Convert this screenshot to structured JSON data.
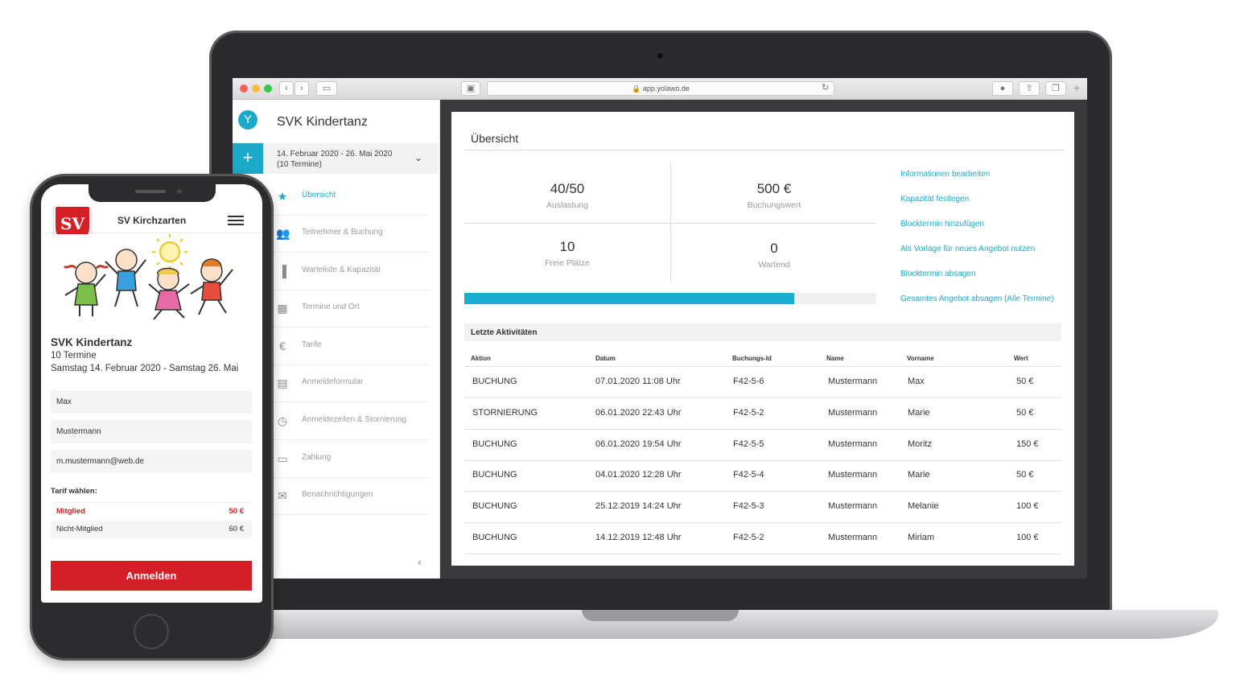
{
  "browser": {
    "url": "app.yolawo.de"
  },
  "sidebar": {
    "title": "SVK Kindertanz",
    "date_range": "14. Februar 2020 - 26. Mai 2020\n(10 Termine)",
    "items": [
      {
        "label": "Übersicht",
        "icon": "star-icon",
        "active": true
      },
      {
        "label": "Teilnehmer & Buchung",
        "icon": "people-icon"
      },
      {
        "label": "Warteliste & Kapazität",
        "icon": "bar-chart-icon"
      },
      {
        "label": "Termine und Ort",
        "icon": "calendar-icon"
      },
      {
        "label": "Tarife",
        "icon": "euro-icon"
      },
      {
        "label": "Anmeldeformular",
        "icon": "clipboard-icon"
      },
      {
        "label": "Anmeldezeiten & Stornierung",
        "icon": "clock-icon"
      },
      {
        "label": "Zahlung",
        "icon": "credit-card-icon"
      },
      {
        "label": "Benachrichtigungen",
        "icon": "mail-icon"
      }
    ]
  },
  "overview": {
    "title": "Übersicht",
    "stats": [
      {
        "value": "40/50",
        "label": "Auslastung"
      },
      {
        "value": "500 €",
        "label": "Buchungswert"
      },
      {
        "value": "10",
        "label": "Freie Plätze"
      },
      {
        "value": "0",
        "label": "Wartend"
      }
    ],
    "capacity_fill_fraction": 0.8,
    "actions": [
      "Informationen bearbeiten",
      "Kapazität festlegen",
      "Blocktermin hinzufügen",
      "Als Vorlage für neues Angebot nutzen",
      "Blocktermin absagen",
      "Gesamtes Angebot absagen (Alle Termine)"
    ],
    "activities_title": "Letzte Aktivitäten",
    "columns": [
      "Aktion",
      "Datum",
      "Buchungs-Id",
      "Name",
      "Vorname",
      "Wert"
    ],
    "rows": [
      [
        "BUCHUNG",
        "07.01.2020 11:08 Uhr",
        "F42-5-6",
        "Mustermann",
        "Max",
        "50 €"
      ],
      [
        "STORNIERUNG",
        "06.01.2020 22:43 Uhr",
        "F42-5-2",
        "Mustermann",
        "Marie",
        "50 €"
      ],
      [
        "BUCHUNG",
        "06.01.2020 19:54 Uhr",
        "F42-5-5",
        "Mustermann",
        "Moritz",
        "150 €"
      ],
      [
        "BUCHUNG",
        "04.01.2020 12:28 Uhr",
        "F42-5-4",
        "Mustermann",
        "Marie",
        "50 €"
      ],
      [
        "BUCHUNG",
        "25.12.2019 14:24 Uhr",
        "F42-5-3",
        "Mustermann",
        "Melanie",
        "100 €"
      ],
      [
        "BUCHUNG",
        "14.12.2019 12:48 Uhr",
        "F42-5-2",
        "Mustermann",
        "Miriam",
        "100 €"
      ]
    ]
  },
  "phone": {
    "club": "SV Kirchzarten",
    "crest_letters": "SV",
    "event": "SVK Kindertanz",
    "termine": "10 Termine",
    "dates": "Samstag 14. Februar 2020 - Samstag 26. Mai",
    "fields": [
      "Max",
      "Mustermann",
      "m.mustermann@web.de"
    ],
    "tarif_label": "Tarif wählen:",
    "tarifs": [
      {
        "name": "Mitglied",
        "price": "50 €",
        "selected": true
      },
      {
        "name": "Nicht-Mitglied",
        "price": "60 €",
        "selected": false
      }
    ],
    "submit": "Anmelden"
  }
}
